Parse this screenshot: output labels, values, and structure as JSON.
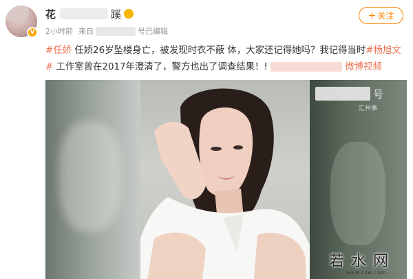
{
  "user": {
    "name_visible": "花",
    "name_tail": "蹊",
    "verified_mark": "V"
  },
  "meta": {
    "time": "2小时前",
    "source_prefix": "来自",
    "source_suffix": "号",
    "edited": "已编辑"
  },
  "follow_button": {
    "icon": "plus-icon",
    "label": "关注",
    "plus": "+"
  },
  "post_text": {
    "tag1": "#任娇",
    "part1": " 任娇26岁坠楼身亡，被发现时衣不蔽 体，大家还记得她吗？我记得当时",
    "tag2": "#杨旭文",
    "tag2_end": "#",
    "part2": " 工作室曾在2017年澄清了，警方也出了调查结果！",
    "mark": "!",
    "video_link": "微博视频"
  },
  "image": {
    "watermark_suffix": "号",
    "watermark_sub": "汇州事"
  },
  "site_watermark": {
    "text": "若水网",
    "sub": "www.rsw.com"
  },
  "colors": {
    "accent": "#ff8200",
    "hashtag": "#eb7350",
    "meta": "#939393"
  }
}
